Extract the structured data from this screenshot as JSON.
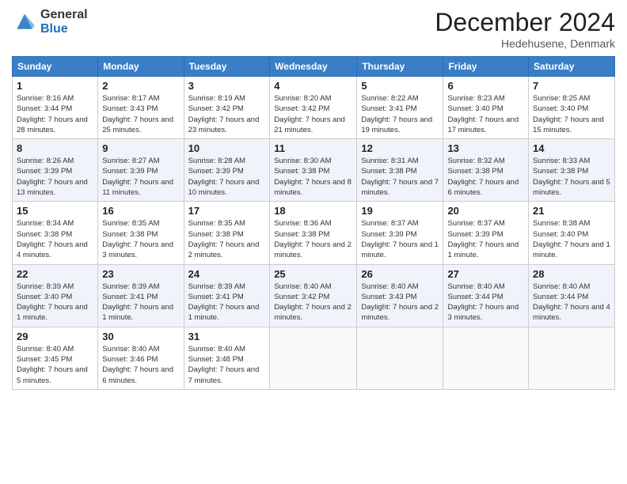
{
  "logo": {
    "general": "General",
    "blue": "Blue"
  },
  "header": {
    "month": "December 2024",
    "location": "Hedehusene, Denmark"
  },
  "weekdays": [
    "Sunday",
    "Monday",
    "Tuesday",
    "Wednesday",
    "Thursday",
    "Friday",
    "Saturday"
  ],
  "weeks": [
    [
      {
        "day": 1,
        "sunrise": "8:16 AM",
        "sunset": "3:44 PM",
        "daylight": "7 hours and 28 minutes."
      },
      {
        "day": 2,
        "sunrise": "8:17 AM",
        "sunset": "3:43 PM",
        "daylight": "7 hours and 25 minutes."
      },
      {
        "day": 3,
        "sunrise": "8:19 AM",
        "sunset": "3:42 PM",
        "daylight": "7 hours and 23 minutes."
      },
      {
        "day": 4,
        "sunrise": "8:20 AM",
        "sunset": "3:42 PM",
        "daylight": "7 hours and 21 minutes."
      },
      {
        "day": 5,
        "sunrise": "8:22 AM",
        "sunset": "3:41 PM",
        "daylight": "7 hours and 19 minutes."
      },
      {
        "day": 6,
        "sunrise": "8:23 AM",
        "sunset": "3:40 PM",
        "daylight": "7 hours and 17 minutes."
      },
      {
        "day": 7,
        "sunrise": "8:25 AM",
        "sunset": "3:40 PM",
        "daylight": "7 hours and 15 minutes."
      }
    ],
    [
      {
        "day": 8,
        "sunrise": "8:26 AM",
        "sunset": "3:39 PM",
        "daylight": "7 hours and 13 minutes."
      },
      {
        "day": 9,
        "sunrise": "8:27 AM",
        "sunset": "3:39 PM",
        "daylight": "7 hours and 11 minutes."
      },
      {
        "day": 10,
        "sunrise": "8:28 AM",
        "sunset": "3:39 PM",
        "daylight": "7 hours and 10 minutes."
      },
      {
        "day": 11,
        "sunrise": "8:30 AM",
        "sunset": "3:38 PM",
        "daylight": "7 hours and 8 minutes."
      },
      {
        "day": 12,
        "sunrise": "8:31 AM",
        "sunset": "3:38 PM",
        "daylight": "7 hours and 7 minutes."
      },
      {
        "day": 13,
        "sunrise": "8:32 AM",
        "sunset": "3:38 PM",
        "daylight": "7 hours and 6 minutes."
      },
      {
        "day": 14,
        "sunrise": "8:33 AM",
        "sunset": "3:38 PM",
        "daylight": "7 hours and 5 minutes."
      }
    ],
    [
      {
        "day": 15,
        "sunrise": "8:34 AM",
        "sunset": "3:38 PM",
        "daylight": "7 hours and 4 minutes."
      },
      {
        "day": 16,
        "sunrise": "8:35 AM",
        "sunset": "3:38 PM",
        "daylight": "7 hours and 3 minutes."
      },
      {
        "day": 17,
        "sunrise": "8:35 AM",
        "sunset": "3:38 PM",
        "daylight": "7 hours and 2 minutes."
      },
      {
        "day": 18,
        "sunrise": "8:36 AM",
        "sunset": "3:38 PM",
        "daylight": "7 hours and 2 minutes."
      },
      {
        "day": 19,
        "sunrise": "8:37 AM",
        "sunset": "3:39 PM",
        "daylight": "7 hours and 1 minute."
      },
      {
        "day": 20,
        "sunrise": "8:37 AM",
        "sunset": "3:39 PM",
        "daylight": "7 hours and 1 minute."
      },
      {
        "day": 21,
        "sunrise": "8:38 AM",
        "sunset": "3:40 PM",
        "daylight": "7 hours and 1 minute."
      }
    ],
    [
      {
        "day": 22,
        "sunrise": "8:39 AM",
        "sunset": "3:40 PM",
        "daylight": "7 hours and 1 minute."
      },
      {
        "day": 23,
        "sunrise": "8:39 AM",
        "sunset": "3:41 PM",
        "daylight": "7 hours and 1 minute."
      },
      {
        "day": 24,
        "sunrise": "8:39 AM",
        "sunset": "3:41 PM",
        "daylight": "7 hours and 1 minute."
      },
      {
        "day": 25,
        "sunrise": "8:40 AM",
        "sunset": "3:42 PM",
        "daylight": "7 hours and 2 minutes."
      },
      {
        "day": 26,
        "sunrise": "8:40 AM",
        "sunset": "3:43 PM",
        "daylight": "7 hours and 2 minutes."
      },
      {
        "day": 27,
        "sunrise": "8:40 AM",
        "sunset": "3:44 PM",
        "daylight": "7 hours and 3 minutes."
      },
      {
        "day": 28,
        "sunrise": "8:40 AM",
        "sunset": "3:44 PM",
        "daylight": "7 hours and 4 minutes."
      }
    ],
    [
      {
        "day": 29,
        "sunrise": "8:40 AM",
        "sunset": "3:45 PM",
        "daylight": "7 hours and 5 minutes."
      },
      {
        "day": 30,
        "sunrise": "8:40 AM",
        "sunset": "3:46 PM",
        "daylight": "7 hours and 6 minutes."
      },
      {
        "day": 31,
        "sunrise": "8:40 AM",
        "sunset": "3:48 PM",
        "daylight": "7 hours and 7 minutes."
      },
      null,
      null,
      null,
      null
    ]
  ],
  "labels": {
    "sunrise": "Sunrise:",
    "sunset": "Sunset:",
    "daylight": "Daylight:"
  }
}
